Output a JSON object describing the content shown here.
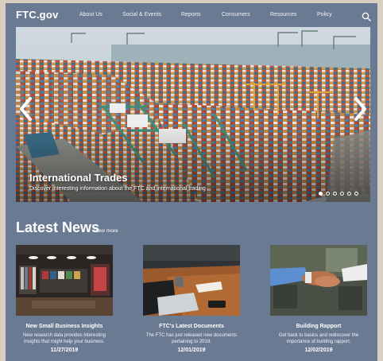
{
  "header": {
    "logo": "FTC.gov",
    "nav": [
      "About Us",
      "Social & Events",
      "Reports",
      "Consumers",
      "Resources",
      "Policy"
    ],
    "search_icon": "search-icon"
  },
  "hero": {
    "title": "International Trades",
    "subtitle": "Discover interesting information about the FTC and international trading",
    "prev_icon": "chevron-left-icon",
    "next_icon": "chevron-right-icon",
    "slide_count": 6,
    "active_slide": 1
  },
  "news": {
    "heading": "Latest News",
    "view_more": "View more",
    "cards": [
      {
        "title": "New Small Business Insights",
        "description": "New research data provides interesting insights that might help your business.",
        "date": "11/27/2019"
      },
      {
        "title": "FTC's Latest Documents",
        "description": "The FTC has just released new documents pertaining to 2019.",
        "date": "12/01/2019"
      },
      {
        "title": "Building Rapport",
        "description": "Get back to basics and rediscover the importance of building rapport.",
        "date": "12/02/2019"
      }
    ]
  },
  "colors": {
    "page_background": "#6b7a93",
    "outer_border": "#d8cfc2",
    "text": "#ffffff"
  }
}
